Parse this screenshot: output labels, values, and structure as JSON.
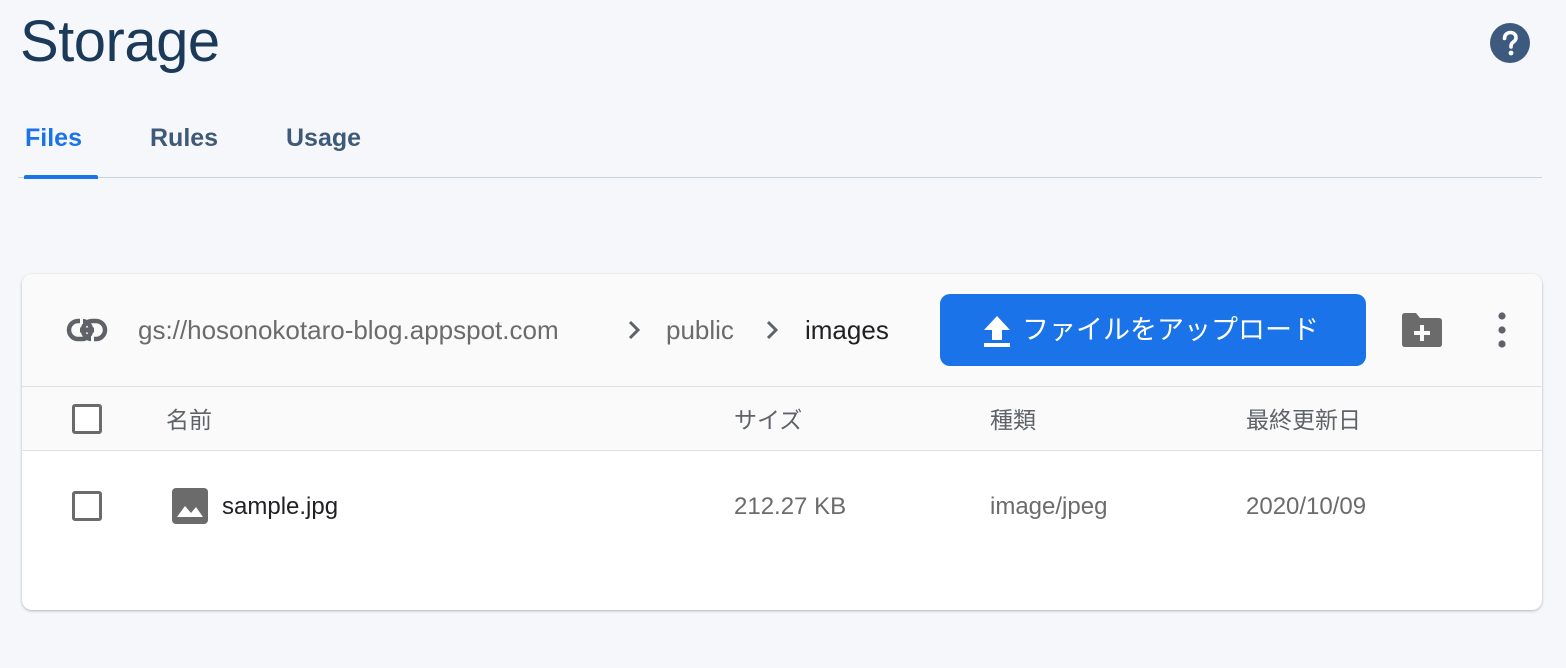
{
  "header": {
    "title": "Storage",
    "help_icon": "help-circle-icon"
  },
  "tabs": [
    {
      "label": "Files",
      "active": true
    },
    {
      "label": "Rules",
      "active": false
    },
    {
      "label": "Usage",
      "active": false
    }
  ],
  "toolbar": {
    "link_icon": "link-icon",
    "breadcrumb": [
      "gs://hosonokotaro-blog.appspot.com",
      "public",
      "images"
    ],
    "upload_label": "ファイルをアップロード",
    "upload_icon": "upload-icon",
    "add_folder_icon": "folder-plus-icon",
    "more_icon": "more-vert-icon"
  },
  "table": {
    "columns": [
      "名前",
      "サイズ",
      "種類",
      "最終更新日"
    ],
    "rows": [
      {
        "name": "sample.jpg",
        "size": "212.27 KB",
        "type": "image/jpeg",
        "modified": "2020/10/09",
        "icon": "image-icon"
      }
    ]
  },
  "colors": {
    "accent": "#1a73e8",
    "title": "#1b3a5a",
    "background": "#f5f7fa"
  }
}
